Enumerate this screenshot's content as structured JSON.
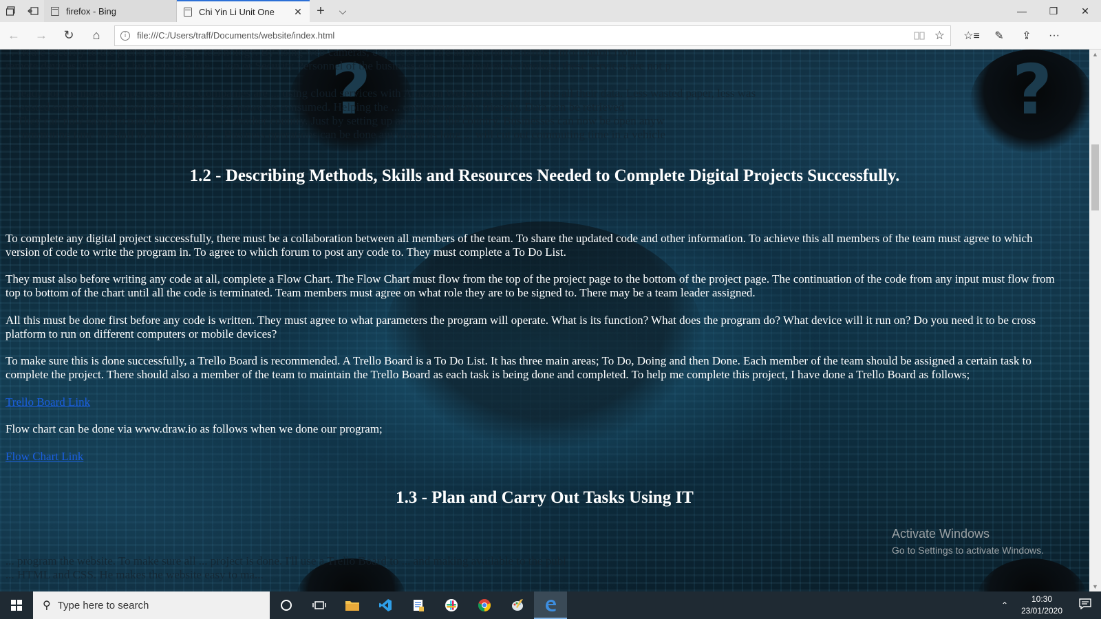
{
  "browser": {
    "tabs": [
      {
        "title": "firefox - Bing",
        "active": false
      },
      {
        "title": "Chi Yin Li Unit One",
        "active": true
      }
    ],
    "tab_close_glyph": "✕",
    "new_tab_glyph": "+",
    "tab_menu_glyph": "⌵",
    "window_controls": {
      "minimize": "—",
      "restore": "❐",
      "close": "✕"
    },
    "nav": {
      "back": "←",
      "forward": "→",
      "refresh": "↻",
      "home": "⌂"
    },
    "url": "file:///C:/Users/traff/Documents/website/index.html",
    "star_glyph": "☆",
    "tools": {
      "favorites": "☆≡",
      "notes": "✎",
      "share": "⇪",
      "more": "···"
    }
  },
  "page": {
    "faded_lines": [
      "... create security to the premises using IT technology. By using web cameras, connected ... fire alarms, flood alarms. Information from",
      "remote devices incase of a break in or a fire ... ion or Security Personnel of the business can ... information technology these services are not p",
      "... ready for the modern paperless office. Companies are ... using cloud services with Amazon Web Services ... to store all their data. Less wasted paper, less was",
      "... wasted space for filing cabinets. These ... Less power is consumed. Helping the ... environmentally friendly. Data can be retrieved",
      "... They can now easily expand their business to another country. Just by setting up another ... the country. Businesses can now be open anyw",
      "... commuting time for staff to the company ... Business operations can be done anywhere as long ... will cut out commuting time in a vehicle"
    ],
    "heading_1_2": "1.2 - Describing Methods, Skills and Resources Needed to Complete Digital Projects Successfully.",
    "paragraphs": [
      "To complete any digital project successfully, there must be a collaboration between all members of the team. To share the updated code and other information. To achieve this all members of the team must agree to which version of code to write the program in. To agree to which forum to post any code to. They must complete a To Do List.",
      "They must also before writing any code at all, complete a Flow Chart. The Flow Chart must flow from the top of the project page to the bottom of the project page. The continuation of the code from any input must flow from top to bottom of the chart until all the code is terminated. Team members must agree on what role they are to be signed to. There may be a team leader assigned.",
      "All this must be done first before any code is written. They must agree to what parameters the program will operate. What is its function? What does the program do? What device will it run on? Do you need it to be cross platform to run on different computers or mobile devices?",
      "To make sure this is done successfully, a Trello Board is recommended. A Trello Board is a To Do List. It has three main areas; To Do, Doing and then Done. Each member of the team should be assigned a certain task to complete the project. There should also a member of the team to maintain the Trello Board as each task is being done and completed. To help me complete this project, I have done a Trello Board as follows;"
    ],
    "trello_link": "Trello Board Link",
    "flowchart_text": "Flow chart can be done via www.draw.io as follows when we done our program;",
    "flowchart_link": "Flow Chart Link",
    "heading_1_3": "1.3 - Plan and Carry Out Tasks Using IT",
    "bottom_faded_lines": [
      "... program the website. To make sure all ... project is done. I'll use a Trello Board to ... and making available to the publ",
      "... HTML and CSS. He makes the website easy to ma..."
    ],
    "activate_windows": {
      "title": "Activate Windows",
      "subtitle": "Go to Settings to activate Windows."
    }
  },
  "taskbar": {
    "search_placeholder": "Type here to search",
    "time": "10:30",
    "date": "23/01/2020",
    "icons": [
      "cortana-icon",
      "task-view-icon",
      "file-explorer-icon",
      "vscode-icon",
      "notepad-icon",
      "slack-icon",
      "chrome-icon",
      "paint-icon",
      "edge-icon"
    ]
  }
}
